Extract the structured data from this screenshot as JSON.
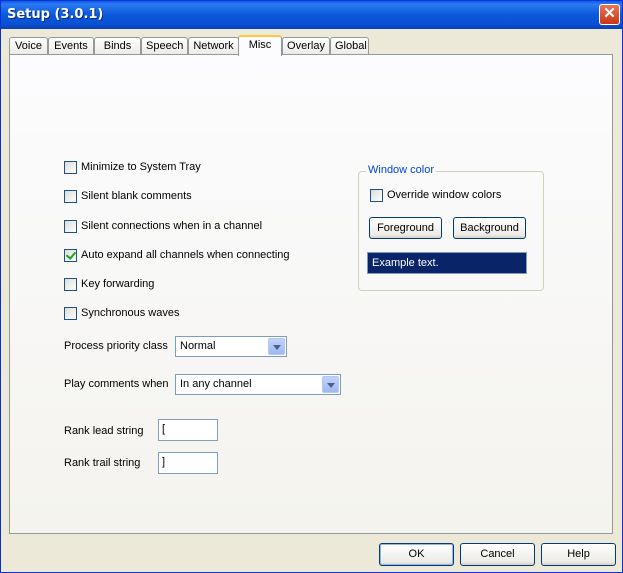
{
  "window": {
    "title": "Setup (3.0.1)",
    "close_glyph": "✕"
  },
  "tabs": [
    {
      "label": "Voice"
    },
    {
      "label": "Events"
    },
    {
      "label": "Binds"
    },
    {
      "label": "Speech"
    },
    {
      "label": "Network"
    },
    {
      "label": "Misc",
      "active": true
    },
    {
      "label": "Overlay"
    },
    {
      "label": "Global"
    }
  ],
  "misc": {
    "checkboxes": [
      {
        "label": "Minimize to System Tray",
        "checked": false
      },
      {
        "label": "Silent blank comments",
        "checked": false
      },
      {
        "label": "Silent connections when in a channel",
        "checked": false
      },
      {
        "label": "Auto expand all channels when connecting",
        "checked": true
      },
      {
        "label": "Key forwarding",
        "checked": false
      },
      {
        "label": "Synchronous waves",
        "checked": false
      }
    ],
    "process_priority": {
      "label": "Process priority class",
      "value": "Normal"
    },
    "play_comments": {
      "label": "Play comments when",
      "value": "In any channel"
    },
    "rank_lead": {
      "label": "Rank lead string",
      "value": "["
    },
    "rank_trail": {
      "label": "Rank trail string",
      "value": "]"
    }
  },
  "window_color": {
    "title": "Window color",
    "override_label": "Override window colors",
    "override_checked": false,
    "foreground_label": "Foreground",
    "background_label": "Background",
    "example_text": "Example text.",
    "example_bg": "#0a246a",
    "example_fg": "#ffffff"
  },
  "footer": {
    "ok": "OK",
    "cancel": "Cancel",
    "help": "Help"
  },
  "colors": {
    "titlebar": "#0a58dc",
    "tab_highlight": "#ffc83c",
    "group_title": "#0046d5"
  }
}
